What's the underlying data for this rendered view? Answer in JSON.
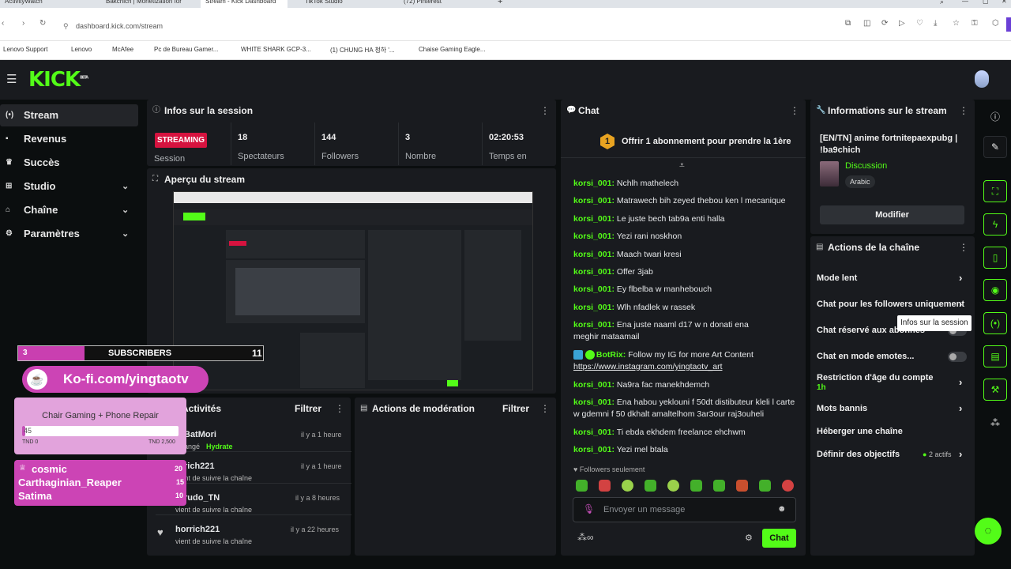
{
  "browser": {
    "tabs": [
      "ActivityWatch",
      "Bakchich | Monetization for",
      "Stream - Kick Dashboard",
      "TikTok Studio",
      "(72) Pinterest"
    ],
    "new_tab": "+",
    "url": "dashboard.kick.com/stream",
    "bookmarks": [
      "Lenovo Support",
      "Lenovo",
      "McAfee",
      "Pc de Bureau Gamer...",
      "WHITE SHARK GCP-3...",
      "(1) CHUNG HA 청하 '...",
      "Chaise Gaming Eagle..."
    ]
  },
  "header": {
    "logo": "KICK",
    "logo_badge": "BETA"
  },
  "sidebar": {
    "items": [
      {
        "label": "Stream",
        "icon": "broadcast-icon"
      },
      {
        "label": "Revenus",
        "icon": "wallet-icon"
      },
      {
        "label": "Succès",
        "icon": "trophy-icon"
      },
      {
        "label": "Studio",
        "icon": "studio-icon"
      },
      {
        "label": "Chaîne",
        "icon": "channel-icon"
      },
      {
        "label": "Paramètres",
        "icon": "gear-icon"
      }
    ]
  },
  "session": {
    "title": "Infos sur la session",
    "status": "STREAMING",
    "status_label": "Session",
    "stats": [
      {
        "value": "18",
        "label": "Spectateurs"
      },
      {
        "value": "144",
        "label": "Followers"
      },
      {
        "value": "3",
        "label": "Nombre"
      },
      {
        "value": "02:20:53",
        "label": "Temps en"
      }
    ]
  },
  "preview": {
    "title": "Aperçu du stream"
  },
  "overlays": {
    "sub_count": "3",
    "sub_label": "SUBSCRIBERS",
    "sub_goal": "11",
    "sub_fraction": 0.27,
    "kofi": "Ko-fi.com/yingtaotv",
    "goal_title": "Chair Gaming + Phone Repair",
    "goal_value": "45",
    "goal_min": "TND 0",
    "goal_max": "TND 2,500",
    "goal_fraction": 0.018,
    "leaderboard": [
      {
        "name": "cosmic",
        "score": "20"
      },
      {
        "name": "Carthaginian_Reaper",
        "score": "15"
      },
      {
        "name": "Satima",
        "score": "10"
      }
    ]
  },
  "activity": {
    "title": "Activités",
    "filter": "Filtrer",
    "items": [
      {
        "user": "BatMori",
        "time": "il y a 1 heure",
        "text": "angé",
        "extra": "Hydrate"
      },
      {
        "user": "rich221",
        "time": "il y a 1 heure",
        "text": "vient de suivre la chaîne",
        "extra": ""
      },
      {
        "user": "rudo_TN",
        "time": "il y a 8 heures",
        "text": "vient de suivre la chaîne",
        "extra": ""
      },
      {
        "user": "horrich221",
        "time": "il y a 22 heures",
        "text": "vient de suivre la chaîne",
        "extra": ""
      }
    ]
  },
  "moderation": {
    "title": "Actions de modération",
    "filter": "Filtrer"
  },
  "chat": {
    "title": "Chat",
    "pinned_rank": "1",
    "pinned": "Offrir 1 abonnement pour prendre la 1ère",
    "messages": [
      {
        "user": "korsi_001:",
        "text": "Nchlh mathelech"
      },
      {
        "user": "korsi_001:",
        "text": "Matrawech bih zeyed thebou ken l mecanique"
      },
      {
        "user": "korsi_001:",
        "text": "Le juste bech tab9a enti halla"
      },
      {
        "user": "korsi_001:",
        "text": "Yezi rani noskhon"
      },
      {
        "user": "korsi_001:",
        "text": "Maach twari kresi"
      },
      {
        "user": "korsi_001:",
        "text": "Offer 3jab"
      },
      {
        "user": "korsi_001:",
        "text": "Ey flbelba w manhebouch"
      },
      {
        "user": "korsi_001:",
        "text": "Wlh nfadlek w rassek"
      },
      {
        "user": "korsi_001:",
        "text": "Ena juste naaml d17 w n donati ena meghir mataamail"
      },
      {
        "user": "BotRix:",
        "text": "Follow my IG for more Art Content",
        "link": "https://www.instagram.com/yingtaotv_art"
      },
      {
        "user": "korsi_001:",
        "text": "Na9ra fac manekhdemch"
      },
      {
        "user": "korsi_001:",
        "text": "Ena habou yeklouni f 50dt distibuteur kleli l carte w gdemni f 50 dkhalt amaltelhom 3ar3our raj3ouheli"
      },
      {
        "user": "korsi_001:",
        "text": "Ti ebda ekhdem freelance ehchwm"
      },
      {
        "user": "korsi_001:",
        "text": "Yezi mel btala"
      }
    ],
    "followers_only": "Followers seulement",
    "input_placeholder": "Envoyer un message",
    "send": "Chat"
  },
  "stream_info": {
    "title": "Informations sur le stream",
    "stream_title": "[EN/TN] anime fortnitepaexpubg | !ba9chich",
    "category": "Discussion",
    "language": "Arabic",
    "edit": "Modifier"
  },
  "channel_actions": {
    "title": "Actions de la chaîne",
    "tooltip": "Infos sur la session",
    "items": [
      {
        "label": "Mode lent",
        "sub": "",
        "type": "chevron"
      },
      {
        "label": "Chat pour les followers uniquement",
        "sub": "",
        "type": "chevron"
      },
      {
        "label": "Chat réservé aux abonnés",
        "sub": "",
        "type": "toggle"
      },
      {
        "label": "Chat en mode emotes...",
        "sub": "",
        "type": "toggle"
      },
      {
        "label": "Restriction d'âge du compte",
        "sub": "1h",
        "type": "chevron"
      },
      {
        "label": "Mots bannis",
        "sub": "",
        "type": "chevron"
      },
      {
        "label": "Héberger une chaîne",
        "sub": "",
        "type": "none"
      },
      {
        "label": "Définir des objectifs",
        "sub": "2 actifs",
        "type": "chevron"
      }
    ]
  },
  "colors": {
    "accent": "#53fc18",
    "live": "#d6133f",
    "panel": "#191b1f",
    "bg": "#0b0e0f"
  }
}
